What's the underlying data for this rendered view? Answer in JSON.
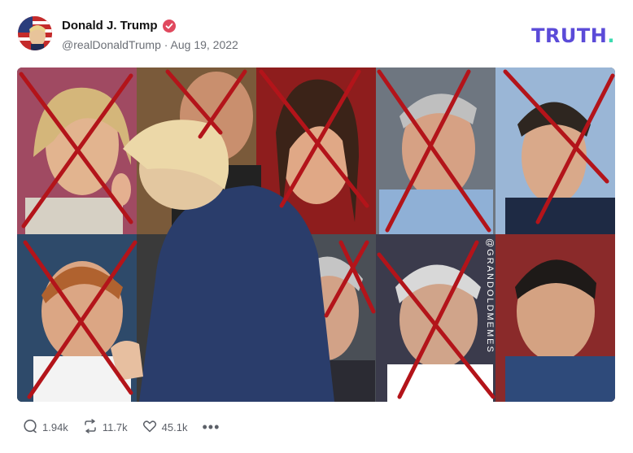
{
  "post": {
    "author_name": "Donald J. Trump",
    "handle_date": "@realDonaldTrump · Aug 19, 2022",
    "brand_text": "TRUTH",
    "brand_dot": "."
  },
  "image": {
    "watermark": "@GRANDOLDMEMES"
  },
  "actions": {
    "replies": "1.94k",
    "retruths": "11.7k",
    "likes": "45.1k",
    "more": "•••"
  },
  "colors": {
    "brand": "#5b4bd8",
    "brand_dot": "#3ddbb0",
    "verified": "#e0495e",
    "cross": "#b3141a"
  },
  "icons": [
    "verified-badge-icon",
    "reply-icon",
    "retruth-icon",
    "heart-icon",
    "more-icon"
  ]
}
